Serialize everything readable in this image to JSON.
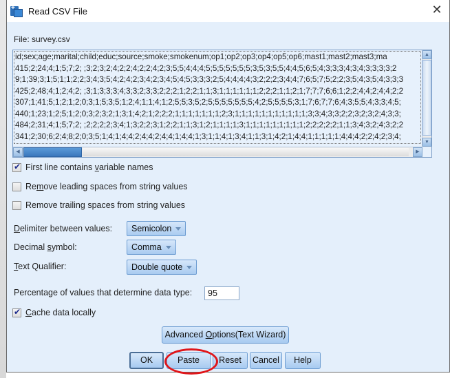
{
  "window": {
    "title": "Read CSV File",
    "close_icon": "close-icon",
    "app_icon": "spss-table-icon"
  },
  "file": {
    "label": "File: survey.csv"
  },
  "preview": {
    "lines": [
      "id;sex;age;marital;child;educ;source;smoke;smokenum;op1;op2;op3;op4;op5;op6;mast1;mast2;mast3;ma",
      "415;2;24;4;1;5;7;2; ;3;2;3;2;4;2;2;4;2;2;4;2;3;5;5;4;4;4;5;5;5;5;5;5;5;3;5;3;5;5;4;4;5;6;5;4;3;3;3;4;3;4;3;3;3;3;2",
      "9;1;39;3;1;5;1;1;2;2;3;4;3;5;4;2;4;2;3;4;2;3;4;5;4;5;3;3;3;2;5;4;4;4;4;3;2;2;2;3;4;4;7;6;5;7;5;2;2;3;5;4;3;5;4;3;3;3",
      "425;2;48;4;1;2;4;2; ;3;1;3;3;3;4;3;3;2;3;3;2;2;2;1;2;2;1;1;3;1;1;1;1;1;1;2;2;2;1;1;2;1;7;7;7;6;6;1;2;2;4;4;2;4;4;2;2",
      "307;1;41;5;1;2;1;2;0;3;1;5;3;5;1;2;4;1;1;4;1;2;5;5;3;5;2;5;5;5;5;5;5;5;4;2;5;5;5;5;3;1;7;6;7;7;6;4;3;5;5;4;3;3;4;5;",
      "440;1;23;1;2;5;1;2;0;3;2;3;2;1;3;1;4;2;1;2;2;2;1;1;1;1;1;1;1;2;3;1;1;1;1;1;1;1;1;1;1;1;3;3;4;3;3;2;2;3;2;3;2;4;3;3;",
      "484;2;31;4;1;5;7;2; ;2;2;2;2;3;4;1;3;2;2;3;1;2;2;1;1;3;1;2;1;1;1;1;3;1;1;1;1;1;1;1;1;1;2;2;2;2;2;1;1;3;4;3;2;4;3;2;2",
      "341;2;30;6;2;4;8;2;0;3;5;1;4;1;4;4;2;4;4;2;4;4;1;4;4;1;3;1;1;4;1;3;4;1;1;3;1;4;2;1;4;4;1;1;1;1;1;4;4;4;2;2;4;2;3;4;"
    ]
  },
  "options": {
    "first_line_names": {
      "pre": "First line contains ",
      "u": "v",
      "post": "ariable names",
      "checked": true
    },
    "remove_leading": {
      "pre": "Re",
      "u": "m",
      "post": "ove leading spaces from string values",
      "checked": false
    },
    "remove_trailing": {
      "pre": "Remove trailin",
      "u": "g",
      "post": " spaces from string values",
      "checked": false
    }
  },
  "form": {
    "delimiter": {
      "label_u": "D",
      "label_rest": "elimiter between values:",
      "value": "Semicolon"
    },
    "decimal": {
      "label_pre": "Decimal ",
      "label_u": "s",
      "label_rest": "ymbol:",
      "value": "Comma"
    },
    "qualifier": {
      "label_u": "T",
      "label_rest": "ext Qualifier:",
      "value": "Double quote"
    },
    "percentage": {
      "label": "Percentage of values that determine data type:",
      "value": "95"
    },
    "cache": {
      "label_u": "C",
      "label_rest": "ache data locally",
      "checked": true
    }
  },
  "buttons": {
    "advanced": {
      "pre": "Advanced ",
      "u": "O",
      "post": "ptions(Text Wizard)"
    },
    "ok": "OK",
    "paste": "Paste",
    "reset": "Reset",
    "cancel": "Cancel",
    "help": "Help"
  },
  "annotation": {
    "highlight_target": "Paste",
    "color": "#e0161a"
  }
}
